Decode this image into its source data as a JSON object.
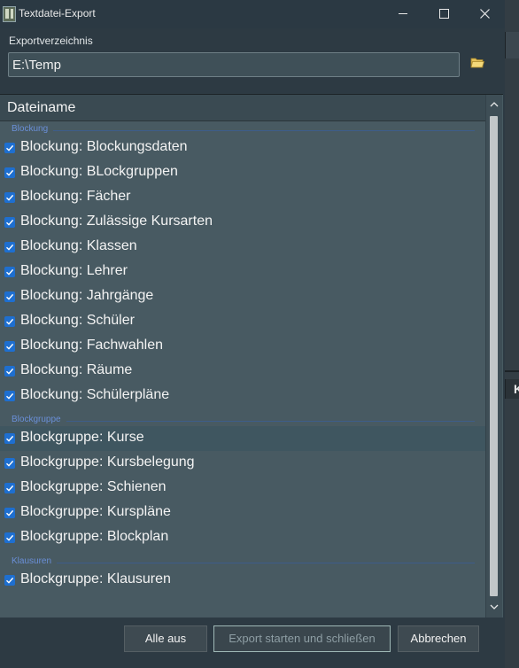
{
  "window": {
    "title": "Textdatei-Export"
  },
  "export": {
    "label": "Exportverzeichnis",
    "path": "E:\\Temp"
  },
  "list": {
    "header": "Dateiname",
    "groups": [
      {
        "name": "Blockung",
        "items": [
          {
            "label": "Blockung: Blockungsdaten",
            "checked": true
          },
          {
            "label": "Blockung: BLockgruppen",
            "checked": true
          },
          {
            "label": "Blockung: Fächer",
            "checked": true
          },
          {
            "label": "Blockung: Zulässige Kursarten",
            "checked": true
          },
          {
            "label": "Blockung: Klassen",
            "checked": true
          },
          {
            "label": "Blockung: Lehrer",
            "checked": true
          },
          {
            "label": "Blockung: Jahrgänge",
            "checked": true
          },
          {
            "label": "Blockung: Schüler",
            "checked": true
          },
          {
            "label": "Blockung: Fachwahlen",
            "checked": true
          },
          {
            "label": "Blockung: Räume",
            "checked": true
          },
          {
            "label": "Blockung: Schülerpläne",
            "checked": true
          }
        ]
      },
      {
        "name": "Blockgruppe",
        "items": [
          {
            "label": "Blockgruppe: Kurse",
            "checked": true,
            "selected": true
          },
          {
            "label": "Blockgruppe: Kursbelegung",
            "checked": true
          },
          {
            "label": "Blockgruppe: Schienen",
            "checked": true
          },
          {
            "label": "Blockgruppe: Kurspläne",
            "checked": true
          },
          {
            "label": "Blockgruppe: Blockplan",
            "checked": true
          }
        ]
      },
      {
        "name": "Klausuren",
        "items": [
          {
            "label": "Blockgruppe: Klausuren",
            "checked": true
          }
        ]
      }
    ]
  },
  "footer": {
    "alle_aus": "Alle aus",
    "export": "Export starten und schließen",
    "abbrechen": "Abbrechen"
  },
  "background_window": {
    "tab_label": "K"
  },
  "colors": {
    "checkbox": "#1e6fd0",
    "group_header": "#6a8fd8",
    "list_bg": "#485a62",
    "selected_row": "#3f5660"
  }
}
